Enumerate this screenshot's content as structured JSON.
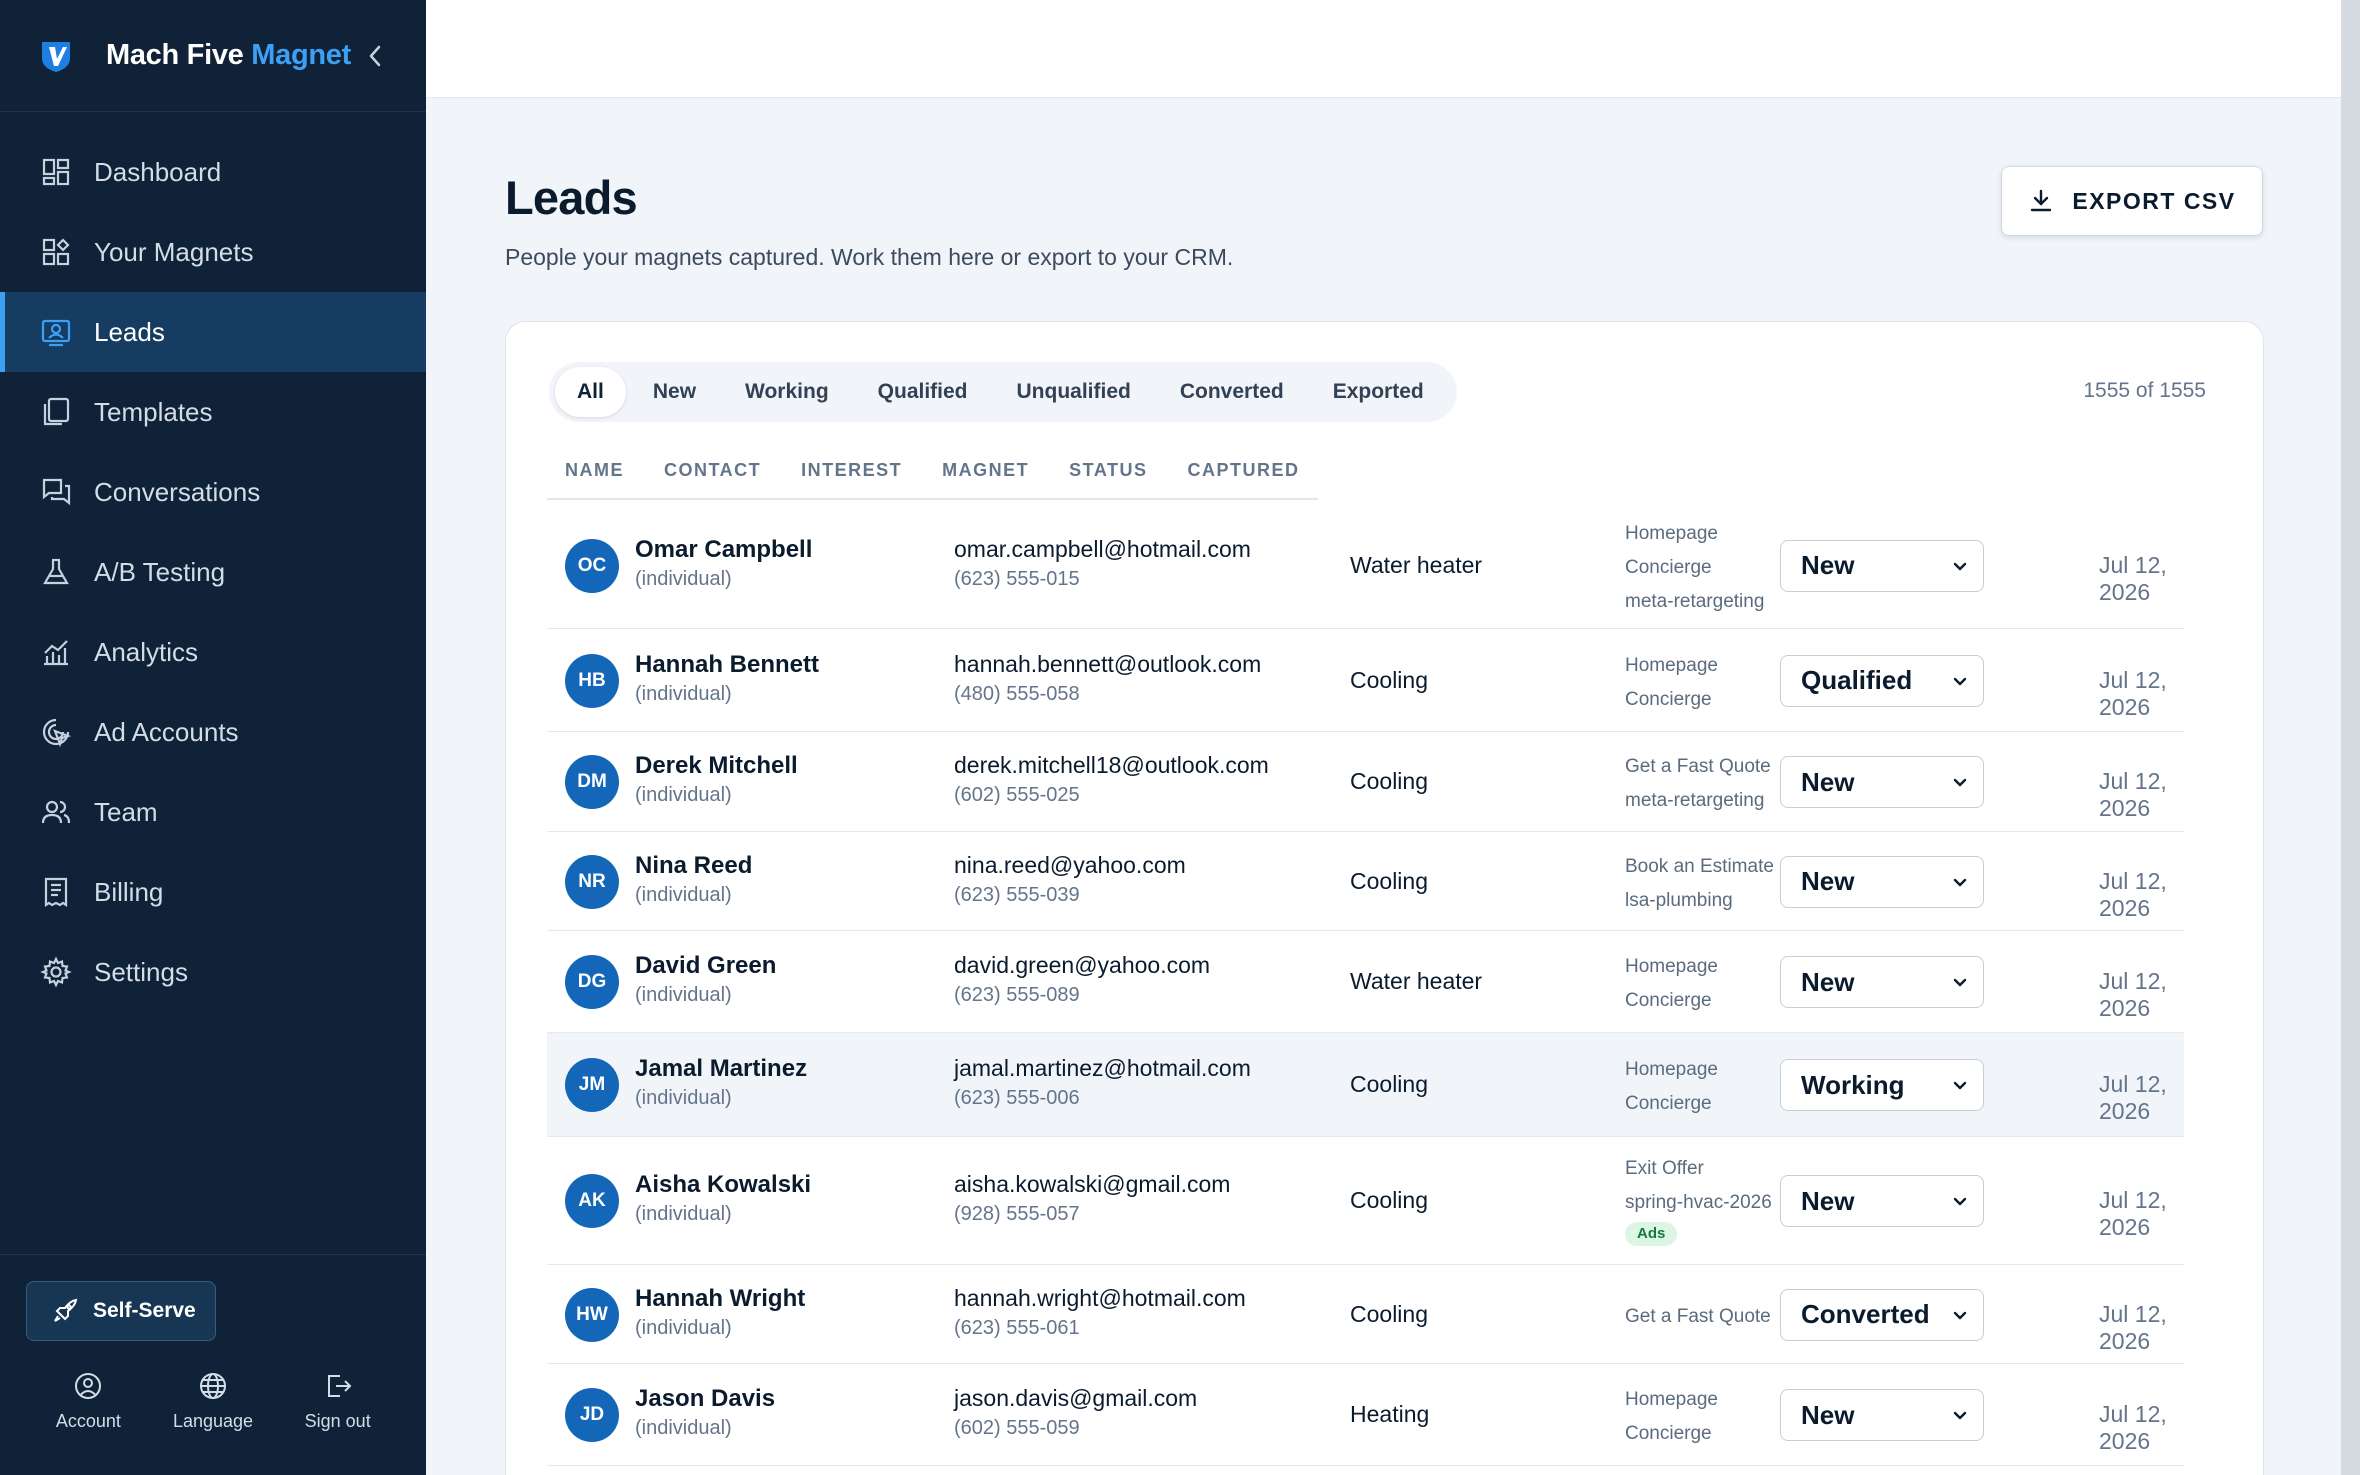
{
  "brand": {
    "name_part1": "Mach Five",
    "name_part2": "Magnet"
  },
  "sidebar": {
    "items": [
      {
        "label": "Dashboard",
        "icon": "dashboard-icon"
      },
      {
        "label": "Your Magnets",
        "icon": "magnets-icon"
      },
      {
        "label": "Leads",
        "icon": "leads-icon",
        "active": true
      },
      {
        "label": "Templates",
        "icon": "templates-icon"
      },
      {
        "label": "Conversations",
        "icon": "conversations-icon"
      },
      {
        "label": "A/B Testing",
        "icon": "flask-icon"
      },
      {
        "label": "Analytics",
        "icon": "analytics-icon"
      },
      {
        "label": "Ad Accounts",
        "icon": "ad-accounts-icon"
      },
      {
        "label": "Team",
        "icon": "team-icon"
      },
      {
        "label": "Billing",
        "icon": "billing-icon"
      },
      {
        "label": "Settings",
        "icon": "gear-icon"
      }
    ],
    "self_serve_label": "Self-Serve",
    "actions": [
      {
        "label": "Account",
        "icon": "account-icon"
      },
      {
        "label": "Language",
        "icon": "globe-icon"
      },
      {
        "label": "Sign out",
        "icon": "sign-out-icon"
      }
    ]
  },
  "page": {
    "title": "Leads",
    "subtitle": "People your magnets captured. Work them here or export to your CRM.",
    "export_label": "EXPORT CSV"
  },
  "tabs": [
    "All",
    "New",
    "Working",
    "Qualified",
    "Unqualified",
    "Converted",
    "Exported"
  ],
  "active_tab": "All",
  "count": "1555 of 1555",
  "columns": [
    "NAME",
    "CONTACT",
    "INTEREST",
    "MAGNET",
    "STATUS",
    "CAPTURED"
  ],
  "leads": [
    {
      "initials": "OC",
      "name": "Omar Campbell",
      "type": "(individual)",
      "email": "omar.campbell@hotmail.com",
      "phone": "(623) 555-015",
      "interest": "Water heater",
      "magnet": [
        "Homepage",
        "Concierge",
        "meta-retargeting"
      ],
      "status": "New",
      "captured": "Jul 12, 2026"
    },
    {
      "initials": "HB",
      "name": "Hannah Bennett",
      "type": "(individual)",
      "email": "hannah.bennett@outlook.com",
      "phone": "(480) 555-058",
      "interest": "Cooling",
      "magnet": [
        "Homepage",
        "Concierge"
      ],
      "status": "Qualified",
      "captured": "Jul 12, 2026"
    },
    {
      "initials": "DM",
      "name": "Derek Mitchell",
      "type": "(individual)",
      "email": "derek.mitchell18@outlook.com",
      "phone": "(602) 555-025",
      "interest": "Cooling",
      "magnet": [
        "Get a Fast Quote",
        "meta-retargeting"
      ],
      "status": "New",
      "captured": "Jul 12, 2026"
    },
    {
      "initials": "NR",
      "name": "Nina Reed",
      "type": "(individual)",
      "email": "nina.reed@yahoo.com",
      "phone": "(623) 555-039",
      "interest": "Cooling",
      "magnet": [
        "Book an Estimate",
        "lsa-plumbing"
      ],
      "status": "New",
      "captured": "Jul 12, 2026"
    },
    {
      "initials": "DG",
      "name": "David Green",
      "type": "(individual)",
      "email": "david.green@yahoo.com",
      "phone": "(623) 555-089",
      "interest": "Water heater",
      "magnet": [
        "Homepage",
        "Concierge"
      ],
      "status": "New",
      "captured": "Jul 12, 2026"
    },
    {
      "initials": "JM",
      "name": "Jamal Martinez",
      "type": "(individual)",
      "email": "jamal.martinez@hotmail.com",
      "phone": "(623) 555-006",
      "interest": "Cooling",
      "magnet": [
        "Homepage",
        "Concierge"
      ],
      "status": "Working",
      "captured": "Jul 12, 2026",
      "highlighted": true
    },
    {
      "initials": "AK",
      "name": "Aisha Kowalski",
      "type": "(individual)",
      "email": "aisha.kowalski@gmail.com",
      "phone": "(928) 555-057",
      "interest": "Cooling",
      "magnet": [
        "Exit Offer",
        "spring-hvac-2026"
      ],
      "badge": "Ads",
      "status": "New",
      "captured": "Jul 12, 2026"
    },
    {
      "initials": "HW",
      "name": "Hannah Wright",
      "type": "(individual)",
      "email": "hannah.wright@hotmail.com",
      "phone": "(623) 555-061",
      "interest": "Cooling",
      "magnet": [
        "Get a Fast Quote"
      ],
      "status": "Converted",
      "captured": "Jul 12, 2026"
    },
    {
      "initials": "JD",
      "name": "Jason Davis",
      "type": "(individual)",
      "email": "jason.davis@gmail.com",
      "phone": "(602) 555-059",
      "interest": "Heating",
      "magnet": [
        "Homepage",
        "Concierge"
      ],
      "status": "New",
      "captured": "Jul 12, 2026"
    }
  ],
  "colors": {
    "sidebar": "#0f2237",
    "accent": "#3ea0f5",
    "avatar": "#1467b8"
  }
}
